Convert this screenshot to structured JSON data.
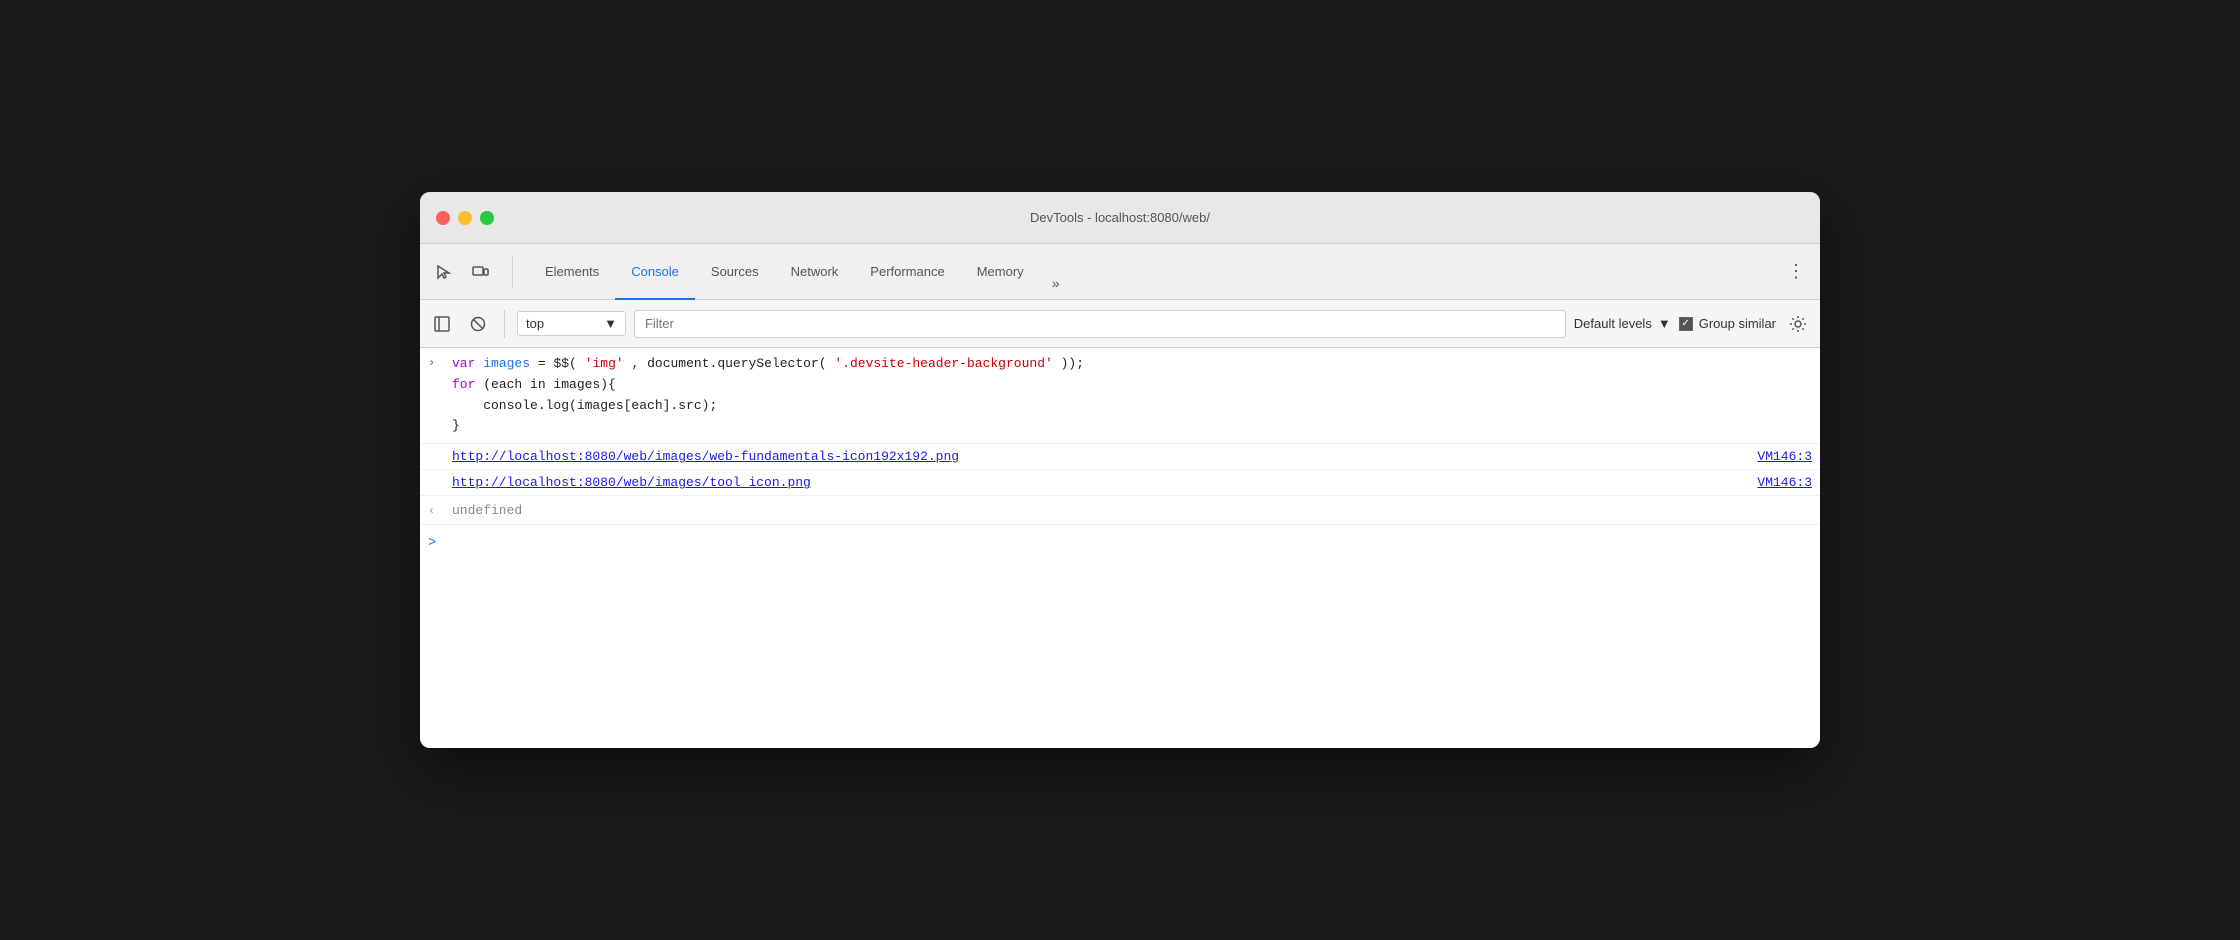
{
  "titleBar": {
    "title": "DevTools - localhost:8080/web/"
  },
  "tabs": {
    "items": [
      {
        "id": "elements",
        "label": "Elements",
        "active": false
      },
      {
        "id": "console",
        "label": "Console",
        "active": true
      },
      {
        "id": "sources",
        "label": "Sources",
        "active": false
      },
      {
        "id": "network",
        "label": "Network",
        "active": false
      },
      {
        "id": "performance",
        "label": "Performance",
        "active": false
      },
      {
        "id": "memory",
        "label": "Memory",
        "active": false
      }
    ],
    "overflow_label": "»",
    "menu_label": "⋮"
  },
  "toolbar": {
    "context": "top",
    "context_arrow": "▼",
    "filter_placeholder": "Filter",
    "default_levels_label": "Default levels",
    "default_levels_arrow": "▼",
    "group_similar_label": "Group similar",
    "checkbox_checked": "✓"
  },
  "console": {
    "entry_arrow": ">",
    "code": {
      "line1_var": "var",
      "line1_name": "images",
      "line1_assign": " = $$(",
      "line1_str": "'img'",
      "line1_mid": ", document.querySelector(",
      "line1_str2": "'.devsite-header-background'",
      "line1_end": "));",
      "line2": "for (each in images){",
      "line3": "    console.log(images[each].src);",
      "line4": "}"
    },
    "links": [
      {
        "url": "http://localhost:8080/web/images/web-fundamentals-icon192x192.png",
        "ref": "VM146:3"
      },
      {
        "url": "http://localhost:8080/web/images/tool_icon.png",
        "ref": "VM146:3"
      }
    ],
    "undefined_arrow": "«",
    "undefined_text": "undefined",
    "input_prompt": ">"
  }
}
